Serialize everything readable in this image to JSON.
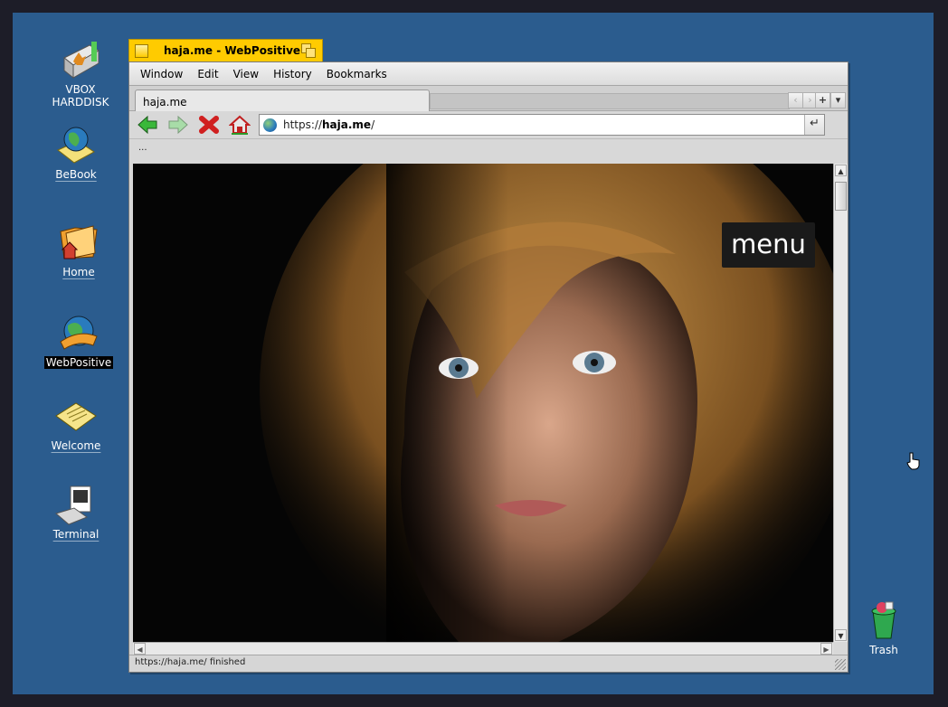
{
  "desktop": {
    "icons": [
      {
        "label": "VBOX HARDDISK",
        "icon": "harddisk-icon"
      },
      {
        "label": "BeBook",
        "icon": "bebook-icon"
      },
      {
        "label": "Home",
        "icon": "home-folder-icon"
      },
      {
        "label": "WebPositive",
        "icon": "webpositive-icon"
      },
      {
        "label": "Welcome",
        "icon": "welcome-icon"
      },
      {
        "label": "Terminal",
        "icon": "terminal-icon"
      },
      {
        "label": "Trash",
        "icon": "trash-icon"
      }
    ]
  },
  "window": {
    "title": "haja.me - WebPositive",
    "menu": [
      "Window",
      "Edit",
      "View",
      "History",
      "Bookmarks"
    ],
    "tab": {
      "label": "haja.me"
    },
    "tab_buttons": [
      "+",
      "▾"
    ],
    "url": {
      "prefix": "https://",
      "host": "haja.me",
      "suffix": "/"
    },
    "go_symbol": "↵",
    "bookmarks_bar": "...",
    "page": {
      "menu_button": "menu",
      "image": "portrait photo of woman with wavy blonde hair"
    },
    "status": "https://haja.me/ finished"
  },
  "colors": {
    "desktop": "#2b5c8e",
    "title_tab": "#ffcb00",
    "frame": "#d8d8d8"
  }
}
